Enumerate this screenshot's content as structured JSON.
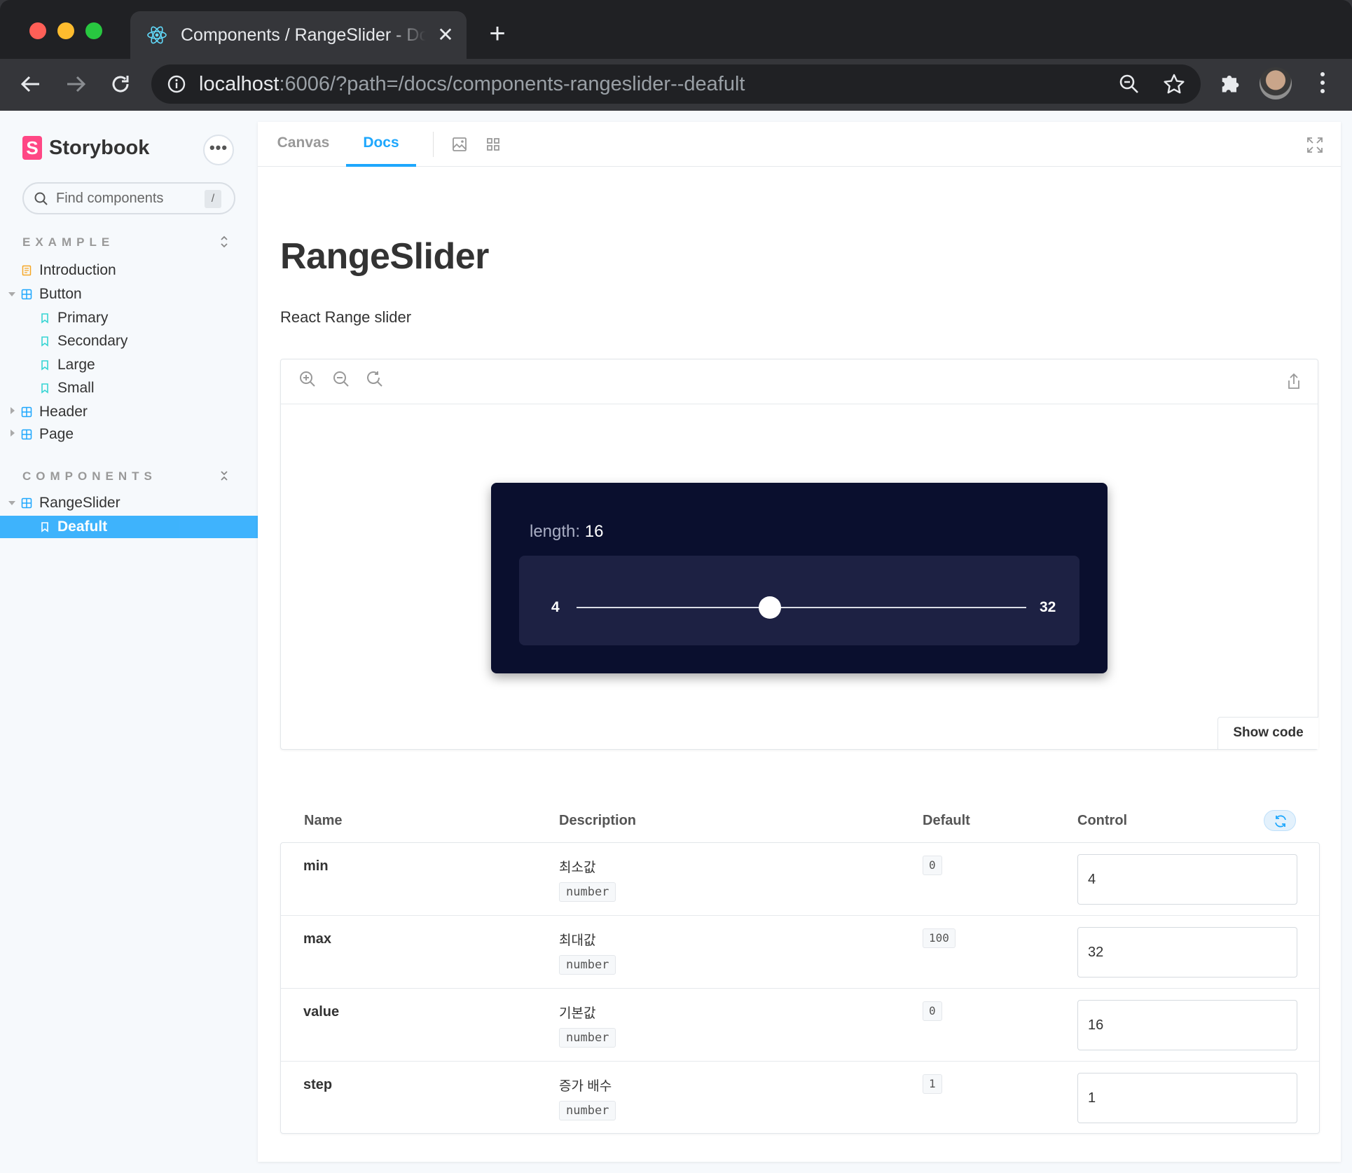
{
  "browser": {
    "tab_title": "Components / RangeSlider - Docs",
    "tab_close": "✕",
    "new_tab": "+",
    "url_host": "localhost",
    "url_rest": ":6006/?path=/docs/components-rangeslider--deafult"
  },
  "sidebar": {
    "brand": "Storybook",
    "brand_mark": "S",
    "menu": "•••",
    "search_placeholder": "Find components",
    "search_shortcut": "/",
    "sections": [
      {
        "heading": "EXAMPLE",
        "items": [
          {
            "label": "Introduction",
            "icon": "document-icon"
          },
          {
            "label": "Button",
            "icon": "component-icon"
          },
          {
            "label": "Primary",
            "icon": "bookmark-icon"
          },
          {
            "label": "Secondary",
            "icon": "bookmark-icon"
          },
          {
            "label": "Large",
            "icon": "bookmark-icon"
          },
          {
            "label": "Small",
            "icon": "bookmark-icon"
          },
          {
            "label": "Header",
            "icon": "component-icon"
          },
          {
            "label": "Page",
            "icon": "component-icon"
          }
        ]
      },
      {
        "heading": "COMPONENTS",
        "items": [
          {
            "label": "RangeSlider",
            "icon": "component-icon"
          },
          {
            "label": "Deafult",
            "icon": "bookmark-icon",
            "selected": true
          }
        ]
      }
    ]
  },
  "toolbar": {
    "tabs": [
      "Canvas",
      "Docs"
    ],
    "active_tab": "Docs"
  },
  "doc": {
    "title": "RangeSlider",
    "subtitle": "React Range slider"
  },
  "preview": {
    "length_label": "length:",
    "length_value": "16",
    "min": "4",
    "max": "32",
    "slider_fraction": 0.43,
    "show_code": "Show code"
  },
  "args_table": {
    "headers": {
      "name": "Name",
      "description": "Description",
      "default": "Default",
      "control": "Control"
    },
    "rows": [
      {
        "name": "min",
        "description": "최소값",
        "type": "number",
        "default": "0",
        "value": "4"
      },
      {
        "name": "max",
        "description": "최대값",
        "type": "number",
        "default": "100",
        "value": "32"
      },
      {
        "name": "value",
        "description": "기본값",
        "type": "number",
        "default": "0",
        "value": "16"
      },
      {
        "name": "step",
        "description": "증가 배수",
        "type": "number",
        "default": "1",
        "value": "1"
      }
    ]
  },
  "colors": {
    "accent": "#1EA7FD",
    "brand": "#FF4785",
    "card_bg": "#0A0F2E",
    "track_box": "#1D2143"
  }
}
